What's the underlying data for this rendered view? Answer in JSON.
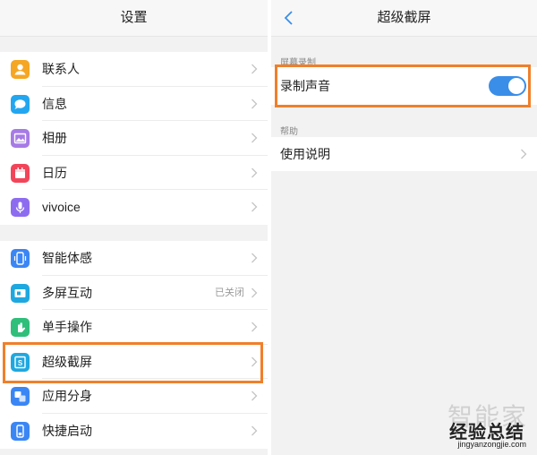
{
  "left_panel": {
    "title": "设置",
    "group1": [
      {
        "label": "联系人",
        "icon": "contacts-icon",
        "color": "#f5a623"
      },
      {
        "label": "信息",
        "icon": "message-icon",
        "color": "#23a6f0"
      },
      {
        "label": "相册",
        "icon": "gallery-icon",
        "color": "#a77be6"
      },
      {
        "label": "日历",
        "icon": "calendar-icon",
        "color": "#f2455a"
      },
      {
        "label": "vivoice",
        "icon": "microphone-icon",
        "color": "#8e6cf0"
      }
    ],
    "group2": [
      {
        "label": "智能体感",
        "icon": "motion-icon",
        "color": "#3b86f5"
      },
      {
        "label": "多屏互动",
        "icon": "multiscreen-icon",
        "color": "#1fa8e0",
        "status": "已关闭"
      },
      {
        "label": "单手操作",
        "icon": "hand-icon",
        "color": "#2fbf7a"
      },
      {
        "label": "超级截屏",
        "icon": "screenshot-icon",
        "color": "#1fa8e0"
      },
      {
        "label": "应用分身",
        "icon": "app-clone-icon",
        "color": "#3b86f5"
      },
      {
        "label": "快捷启动",
        "icon": "quick-launch-icon",
        "color": "#3b86f5"
      }
    ]
  },
  "right_panel": {
    "title": "超级截屏",
    "section_record": "屏幕录制",
    "record_sound_label": "录制声音",
    "record_sound_on": true,
    "section_help": "帮助",
    "help_label": "使用说明"
  },
  "watermark": {
    "ghost": "智能家",
    "main": "经验总结",
    "url": "jingyanzongjie.com"
  },
  "colors": {
    "highlight": "#f07f2a",
    "toggle_on": "#3a8ee8"
  }
}
